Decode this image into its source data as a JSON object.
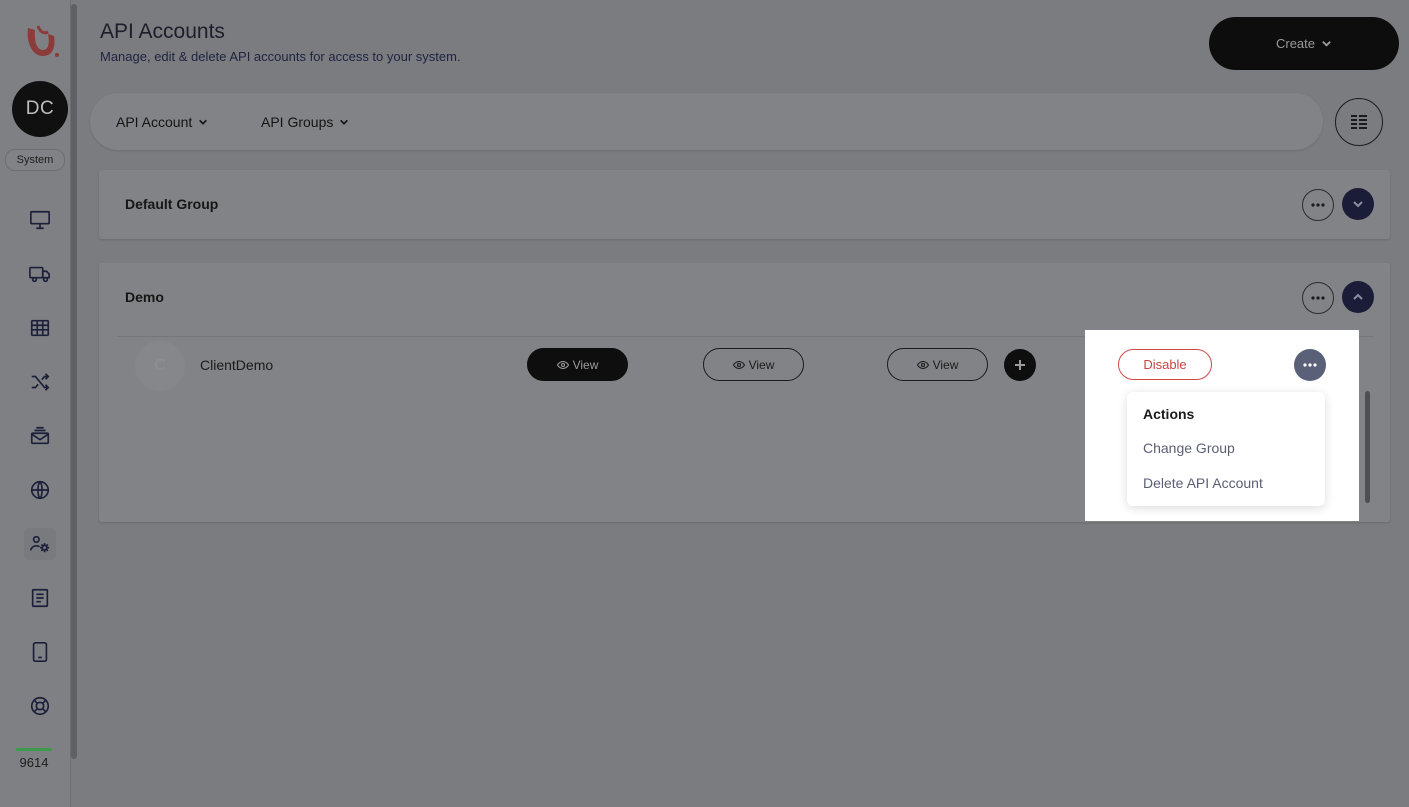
{
  "sidebar": {
    "avatar_initials": "DC",
    "role": "System",
    "usage_count": "9614",
    "nav_icons": [
      "monitor-icon",
      "truck-icon",
      "table-icon",
      "shuffle-icon",
      "mail-stack-icon",
      "globe-icon",
      "users-cog-icon",
      "book-icon",
      "tablet-icon",
      "lifebuoy-icon"
    ],
    "active_icon": "users-cog-icon"
  },
  "header": {
    "title": "API Accounts",
    "subtitle": "Manage, edit & delete API accounts for access to your system.",
    "create_label": "Create"
  },
  "filters": {
    "items": [
      {
        "label": "API Account"
      },
      {
        "label": "API Groups"
      }
    ]
  },
  "groups": [
    {
      "name": "Default Group",
      "expanded": false
    },
    {
      "name": "Demo",
      "expanded": true,
      "accounts": [
        {
          "initial": "C",
          "name": "ClientDemo",
          "view_labels": [
            "View",
            "View",
            "View"
          ],
          "disable_label": "Disable"
        }
      ]
    }
  ],
  "actions_menu": {
    "heading": "Actions",
    "items": [
      "Change Group",
      "Delete API Account"
    ]
  },
  "colors": {
    "accent_dark": "#1b1d38",
    "danger": "#c94440",
    "usage": "#3c9a4d"
  }
}
